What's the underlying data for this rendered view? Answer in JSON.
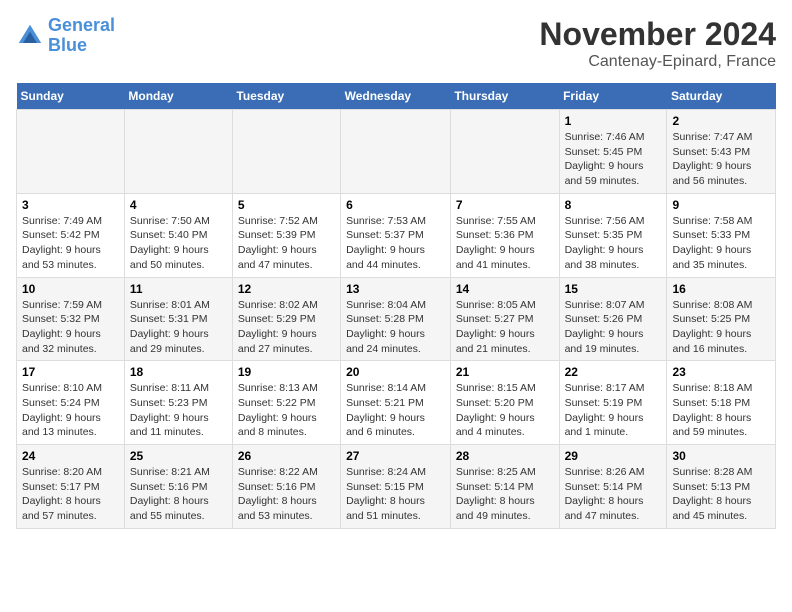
{
  "logo": {
    "line1": "General",
    "line2": "Blue"
  },
  "title": "November 2024",
  "subtitle": "Cantenay-Epinard, France",
  "headers": [
    "Sunday",
    "Monday",
    "Tuesday",
    "Wednesday",
    "Thursday",
    "Friday",
    "Saturday"
  ],
  "weeks": [
    [
      {
        "num": "",
        "info": ""
      },
      {
        "num": "",
        "info": ""
      },
      {
        "num": "",
        "info": ""
      },
      {
        "num": "",
        "info": ""
      },
      {
        "num": "",
        "info": ""
      },
      {
        "num": "1",
        "info": "Sunrise: 7:46 AM\nSunset: 5:45 PM\nDaylight: 9 hours and 59 minutes."
      },
      {
        "num": "2",
        "info": "Sunrise: 7:47 AM\nSunset: 5:43 PM\nDaylight: 9 hours and 56 minutes."
      }
    ],
    [
      {
        "num": "3",
        "info": "Sunrise: 7:49 AM\nSunset: 5:42 PM\nDaylight: 9 hours and 53 minutes."
      },
      {
        "num": "4",
        "info": "Sunrise: 7:50 AM\nSunset: 5:40 PM\nDaylight: 9 hours and 50 minutes."
      },
      {
        "num": "5",
        "info": "Sunrise: 7:52 AM\nSunset: 5:39 PM\nDaylight: 9 hours and 47 minutes."
      },
      {
        "num": "6",
        "info": "Sunrise: 7:53 AM\nSunset: 5:37 PM\nDaylight: 9 hours and 44 minutes."
      },
      {
        "num": "7",
        "info": "Sunrise: 7:55 AM\nSunset: 5:36 PM\nDaylight: 9 hours and 41 minutes."
      },
      {
        "num": "8",
        "info": "Sunrise: 7:56 AM\nSunset: 5:35 PM\nDaylight: 9 hours and 38 minutes."
      },
      {
        "num": "9",
        "info": "Sunrise: 7:58 AM\nSunset: 5:33 PM\nDaylight: 9 hours and 35 minutes."
      }
    ],
    [
      {
        "num": "10",
        "info": "Sunrise: 7:59 AM\nSunset: 5:32 PM\nDaylight: 9 hours and 32 minutes."
      },
      {
        "num": "11",
        "info": "Sunrise: 8:01 AM\nSunset: 5:31 PM\nDaylight: 9 hours and 29 minutes."
      },
      {
        "num": "12",
        "info": "Sunrise: 8:02 AM\nSunset: 5:29 PM\nDaylight: 9 hours and 27 minutes."
      },
      {
        "num": "13",
        "info": "Sunrise: 8:04 AM\nSunset: 5:28 PM\nDaylight: 9 hours and 24 minutes."
      },
      {
        "num": "14",
        "info": "Sunrise: 8:05 AM\nSunset: 5:27 PM\nDaylight: 9 hours and 21 minutes."
      },
      {
        "num": "15",
        "info": "Sunrise: 8:07 AM\nSunset: 5:26 PM\nDaylight: 9 hours and 19 minutes."
      },
      {
        "num": "16",
        "info": "Sunrise: 8:08 AM\nSunset: 5:25 PM\nDaylight: 9 hours and 16 minutes."
      }
    ],
    [
      {
        "num": "17",
        "info": "Sunrise: 8:10 AM\nSunset: 5:24 PM\nDaylight: 9 hours and 13 minutes."
      },
      {
        "num": "18",
        "info": "Sunrise: 8:11 AM\nSunset: 5:23 PM\nDaylight: 9 hours and 11 minutes."
      },
      {
        "num": "19",
        "info": "Sunrise: 8:13 AM\nSunset: 5:22 PM\nDaylight: 9 hours and 8 minutes."
      },
      {
        "num": "20",
        "info": "Sunrise: 8:14 AM\nSunset: 5:21 PM\nDaylight: 9 hours and 6 minutes."
      },
      {
        "num": "21",
        "info": "Sunrise: 8:15 AM\nSunset: 5:20 PM\nDaylight: 9 hours and 4 minutes."
      },
      {
        "num": "22",
        "info": "Sunrise: 8:17 AM\nSunset: 5:19 PM\nDaylight: 9 hours and 1 minute."
      },
      {
        "num": "23",
        "info": "Sunrise: 8:18 AM\nSunset: 5:18 PM\nDaylight: 8 hours and 59 minutes."
      }
    ],
    [
      {
        "num": "24",
        "info": "Sunrise: 8:20 AM\nSunset: 5:17 PM\nDaylight: 8 hours and 57 minutes."
      },
      {
        "num": "25",
        "info": "Sunrise: 8:21 AM\nSunset: 5:16 PM\nDaylight: 8 hours and 55 minutes."
      },
      {
        "num": "26",
        "info": "Sunrise: 8:22 AM\nSunset: 5:16 PM\nDaylight: 8 hours and 53 minutes."
      },
      {
        "num": "27",
        "info": "Sunrise: 8:24 AM\nSunset: 5:15 PM\nDaylight: 8 hours and 51 minutes."
      },
      {
        "num": "28",
        "info": "Sunrise: 8:25 AM\nSunset: 5:14 PM\nDaylight: 8 hours and 49 minutes."
      },
      {
        "num": "29",
        "info": "Sunrise: 8:26 AM\nSunset: 5:14 PM\nDaylight: 8 hours and 47 minutes."
      },
      {
        "num": "30",
        "info": "Sunrise: 8:28 AM\nSunset: 5:13 PM\nDaylight: 8 hours and 45 minutes."
      }
    ]
  ]
}
